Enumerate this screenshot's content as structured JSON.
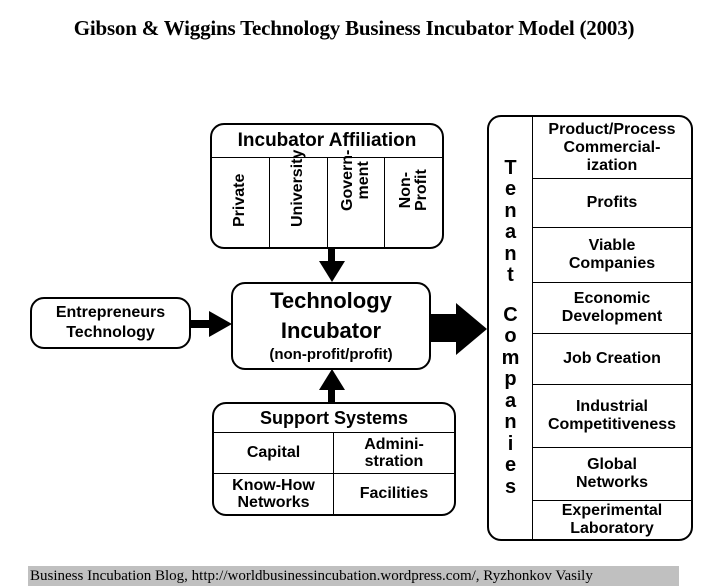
{
  "title": "Gibson & Wiggins Technology Business Incubator Model (2003)",
  "affiliation": {
    "heading": "Incubator Affiliation",
    "columns": [
      "Private",
      "University",
      "Govern-\nment",
      "Non-\nProfit"
    ]
  },
  "entrepreneurs": {
    "line1": "Entrepreneurs",
    "line2": "Technology"
  },
  "incubator": {
    "line1": "Technology",
    "line2": "Incubator",
    "line3": "(non-profit/profit)"
  },
  "support": {
    "heading": "Support Systems",
    "cells": [
      "Capital",
      "Admini-\nstration",
      "Know-How\nNetworks",
      "Facilities"
    ]
  },
  "tenant": {
    "side_word1": [
      "T",
      "e",
      "n",
      "a",
      "n",
      "t"
    ],
    "side_word2": [
      "C",
      "o",
      "m",
      "p",
      "a",
      "n",
      "i",
      "e",
      "s"
    ],
    "outcomes": [
      "Product/Process\nCommercial-\nization",
      "Profits",
      "Viable\nCompanies",
      "Economic\nDevelopment",
      "Job Creation",
      "Industrial\nCompetitiveness",
      "Global\nNetworks",
      "Experimental\nLaboratory"
    ]
  },
  "footer": "Business Incubation Blog, http://worldbusinessincubation.wordpress.com/, Ryzhonkov Vasily"
}
